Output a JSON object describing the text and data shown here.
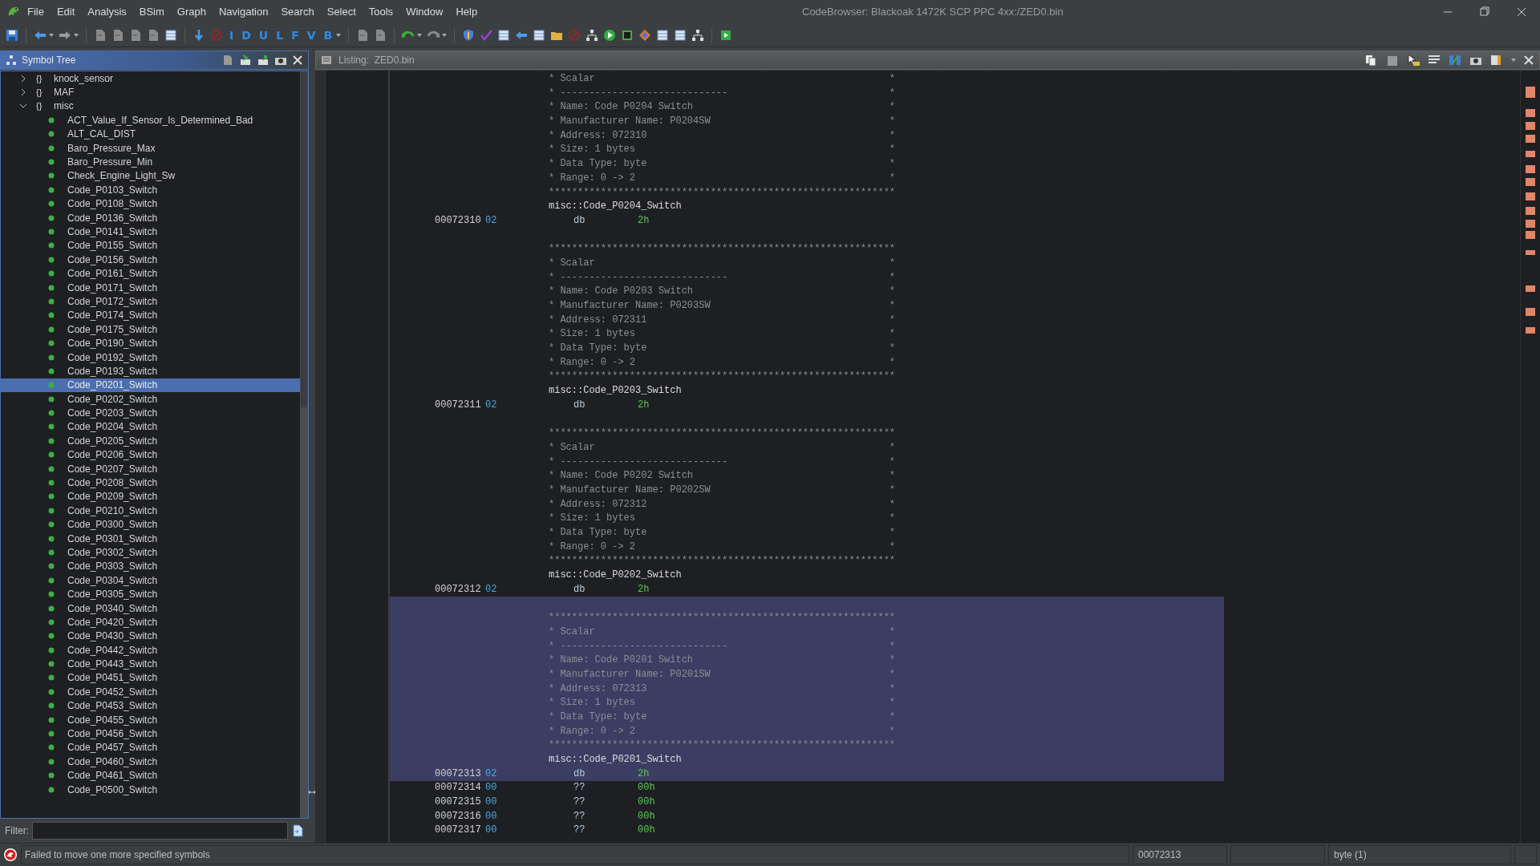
{
  "window": {
    "title": "CodeBrowser: Blackoak 1472K SCP PPC 4xx:/ZED0.bin"
  },
  "menu": [
    "File",
    "Edit",
    "Analysis",
    "BSim",
    "Graph",
    "Navigation",
    "Search",
    "Select",
    "Tools",
    "Window",
    "Help"
  ],
  "toolbar": {
    "letter_buttons": [
      "I",
      "D",
      "U",
      "L",
      "F",
      "V",
      "B"
    ]
  },
  "symbol_tree": {
    "title": "Symbol Tree",
    "filter_label": "Filter:",
    "items": [
      {
        "glyph": "{}",
        "label": "knock_sensor",
        "expanded": false,
        "selected": false
      },
      {
        "glyph": "{}",
        "label": "MAF",
        "expanded": false,
        "selected": false
      },
      {
        "glyph": "{}",
        "label": "misc",
        "expanded": true,
        "selected": false,
        "children": [
          {
            "label": "ACT_Value_If_Sensor_Is_Determined_Bad",
            "selected": false
          },
          {
            "label": "ALT_CAL_DIST",
            "selected": false
          },
          {
            "label": "Baro_Pressure_Max",
            "selected": false
          },
          {
            "label": "Baro_Pressure_Min",
            "selected": false
          },
          {
            "label": "Check_Engine_Light_Sw",
            "selected": false
          },
          {
            "label": "Code_P0103_Switch",
            "selected": false
          },
          {
            "label": "Code_P0108_Switch",
            "selected": false
          },
          {
            "label": "Code_P0136_Switch",
            "selected": false
          },
          {
            "label": "Code_P0141_Switch",
            "selected": false
          },
          {
            "label": "Code_P0155_Switch",
            "selected": false
          },
          {
            "label": "Code_P0156_Switch",
            "selected": false
          },
          {
            "label": "Code_P0161_Switch",
            "selected": false
          },
          {
            "label": "Code_P0171_Switch",
            "selected": false
          },
          {
            "label": "Code_P0172_Switch",
            "selected": false
          },
          {
            "label": "Code_P0174_Switch",
            "selected": false
          },
          {
            "label": "Code_P0175_Switch",
            "selected": false
          },
          {
            "label": "Code_P0190_Switch",
            "selected": false
          },
          {
            "label": "Code_P0192_Switch",
            "selected": false
          },
          {
            "label": "Code_P0193_Switch",
            "selected": false
          },
          {
            "label": "Code_P0201_Switch",
            "selected": true
          },
          {
            "label": "Code_P0202_Switch",
            "selected": false
          },
          {
            "label": "Code_P0203_Switch",
            "selected": false
          },
          {
            "label": "Code_P0204_Switch",
            "selected": false
          },
          {
            "label": "Code_P0205_Switch",
            "selected": false
          },
          {
            "label": "Code_P0206_Switch",
            "selected": false
          },
          {
            "label": "Code_P0207_Switch",
            "selected": false
          },
          {
            "label": "Code_P0208_Switch",
            "selected": false
          },
          {
            "label": "Code_P0209_Switch",
            "selected": false
          },
          {
            "label": "Code_P0210_Switch",
            "selected": false
          },
          {
            "label": "Code_P0300_Switch",
            "selected": false
          },
          {
            "label": "Code_P0301_Switch",
            "selected": false
          },
          {
            "label": "Code_P0302_Switch",
            "selected": false
          },
          {
            "label": "Code_P0303_Switch",
            "selected": false
          },
          {
            "label": "Code_P0304_Switch",
            "selected": false
          },
          {
            "label": "Code_P0305_Switch",
            "selected": false
          },
          {
            "label": "Code_P0340_Switch",
            "selected": false
          },
          {
            "label": "Code_P0420_Switch",
            "selected": false
          },
          {
            "label": "Code_P0430_Switch",
            "selected": false
          },
          {
            "label": "Code_P0442_Switch",
            "selected": false
          },
          {
            "label": "Code_P0443_Switch",
            "selected": false
          },
          {
            "label": "Code_P0451_Switch",
            "selected": false
          },
          {
            "label": "Code_P0452_Switch",
            "selected": false
          },
          {
            "label": "Code_P0453_Switch",
            "selected": false
          },
          {
            "label": "Code_P0455_Switch",
            "selected": false
          },
          {
            "label": "Code_P0456_Switch",
            "selected": false
          },
          {
            "label": "Code_P0457_Switch",
            "selected": false
          },
          {
            "label": "Code_P0460_Switch",
            "selected": false
          },
          {
            "label": "Code_P0461_Switch",
            "selected": false
          },
          {
            "label": "Code_P0500_Switch",
            "selected": false
          }
        ]
      }
    ]
  },
  "listing": {
    "title": "Listing:  ZED0.bin",
    "entries": [
      {
        "kind": "block",
        "selected": false,
        "comment": [
          "* Scalar                                                   *",
          "* -----------------------------                            *",
          "* Name: Code P0204 Switch                                  *",
          "* Manufacturer Name: P0204SW                               *",
          "* Address: 072310                                          *",
          "* Size: 1 bytes                                            *",
          "* Data Type: byte                                          *",
          "* Range: 0 -> 2                                            *",
          "************************************************************"
        ],
        "label": "misc::Code_P0204_Switch",
        "address": "00072310",
        "bytes": "02",
        "mnemonic": "db",
        "operand": "2h"
      },
      {
        "kind": "block",
        "selected": false,
        "comment": [
          "************************************************************",
          "* Scalar                                                   *",
          "* -----------------------------                            *",
          "* Name: Code P0203 Switch                                  *",
          "* Manufacturer Name: P0203SW                               *",
          "* Address: 072311                                          *",
          "* Size: 1 bytes                                            *",
          "* Data Type: byte                                          *",
          "* Range: 0 -> 2                                            *",
          "************************************************************"
        ],
        "label": "misc::Code_P0203_Switch",
        "address": "00072311",
        "bytes": "02",
        "mnemonic": "db",
        "operand": "2h"
      },
      {
        "kind": "block",
        "selected": false,
        "comment": [
          "************************************************************",
          "* Scalar                                                   *",
          "* -----------------------------                            *",
          "* Name: Code P0202 Switch                                  *",
          "* Manufacturer Name: P0202SW                               *",
          "* Address: 072312                                          *",
          "* Size: 1 bytes                                            *",
          "* Data Type: byte                                          *",
          "* Range: 0 -> 2                                            *",
          "************************************************************"
        ],
        "label": "misc::Code_P0202_Switch",
        "address": "00072312",
        "bytes": "02",
        "mnemonic": "db",
        "operand": "2h"
      },
      {
        "kind": "block",
        "selected": true,
        "comment": [
          "************************************************************",
          "* Scalar                                                   *",
          "* -----------------------------                            *",
          "* Name: Code P0201 Switch                                  *",
          "* Manufacturer Name: P0201SW                               *",
          "* Address: 072313                                          *",
          "* Size: 1 bytes                                            *",
          "* Data Type: byte                                          *",
          "* Range: 0 -> 2                                            *",
          "************************************************************"
        ],
        "label": "misc::Code_P0201_Switch",
        "address": "00072313",
        "bytes": "02",
        "mnemonic": "db",
        "operand": "2h"
      },
      {
        "kind": "row",
        "selected": false,
        "address": "00072314",
        "bytes": "00",
        "mnemonic": "??",
        "operand": "00h"
      },
      {
        "kind": "row",
        "selected": false,
        "address": "00072315",
        "bytes": "00",
        "mnemonic": "??",
        "operand": "00h"
      },
      {
        "kind": "row",
        "selected": false,
        "address": "00072316",
        "bytes": "00",
        "mnemonic": "??",
        "operand": "00h"
      },
      {
        "kind": "row",
        "selected": false,
        "address": "00072317",
        "bytes": "00",
        "mnemonic": "??",
        "operand": "00h"
      }
    ]
  },
  "status_bar": {
    "message": "Failed to move one more specified symbols",
    "fields": [
      "00072313",
      "byte  (1)"
    ]
  }
}
